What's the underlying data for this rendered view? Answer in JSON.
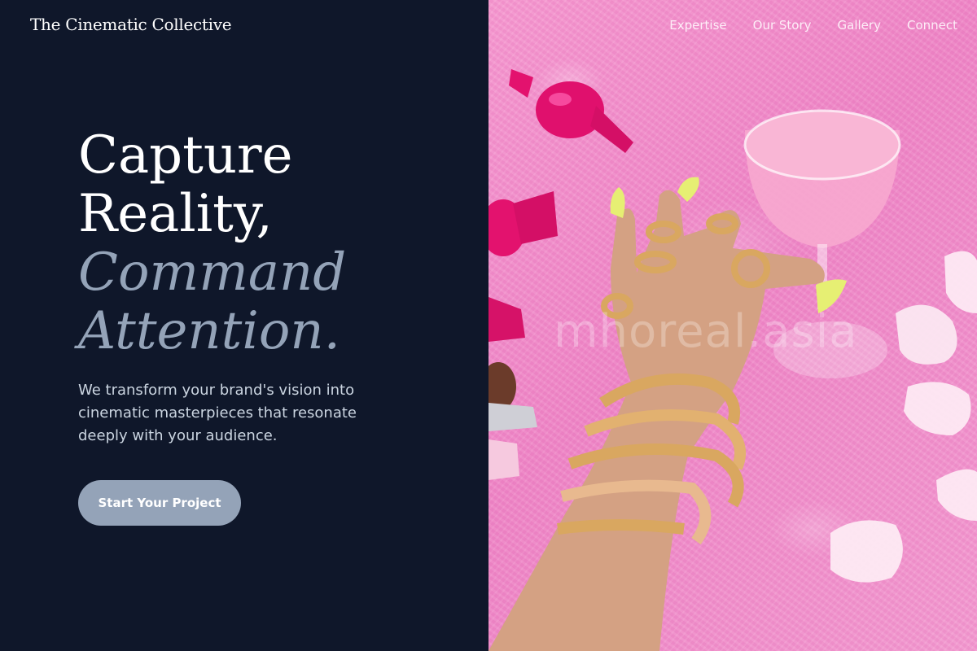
{
  "brand": {
    "logo_text": "The Cinematic Collective"
  },
  "nav": {
    "items": [
      "Expertise",
      "Our Story",
      "Gallery",
      "Connect"
    ]
  },
  "hero": {
    "line1": "Capture",
    "line2": "Reality,",
    "line3": "Command",
    "line4": "Attention.",
    "tagline": "We transform your brand's vision into cinematic masterpieces that resonate deeply with your audience.",
    "cta_label": "Start Your Project"
  },
  "photo": {
    "watermark_text": "mhoreal.asia"
  },
  "colors": {
    "background": "#0f172a",
    "accent": "#94a3b8",
    "tagline": "#cbd5e1",
    "photo_pink": "#ee86c6"
  }
}
